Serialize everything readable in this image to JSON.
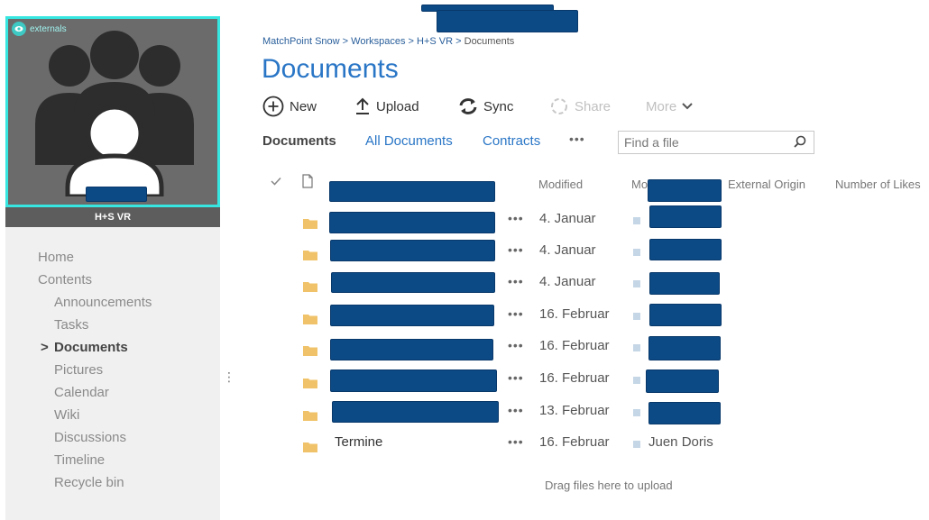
{
  "site": {
    "badge_label": "externals",
    "name": "H+S VR"
  },
  "breadcrumb": {
    "items": [
      "MatchPoint Snow",
      "Workspaces",
      "H+S VR"
    ],
    "separator": " > ",
    "current": "Documents"
  },
  "page_title": "Documents",
  "quick_launch": {
    "items": [
      {
        "label": "Home",
        "level": 0
      },
      {
        "label": "Contents",
        "level": 0
      },
      {
        "label": "Announcements",
        "level": 1
      },
      {
        "label": "Tasks",
        "level": 1
      },
      {
        "label": "Documents",
        "level": 1,
        "active": true
      },
      {
        "label": "Pictures",
        "level": 1
      },
      {
        "label": "Calendar",
        "level": 1
      },
      {
        "label": "Wiki",
        "level": 1
      },
      {
        "label": "Discussions",
        "level": 1
      },
      {
        "label": "Timeline",
        "level": 1
      },
      {
        "label": "Recycle bin",
        "level": 1
      }
    ],
    "active_marker": ">"
  },
  "commands": {
    "new": "New",
    "upload": "Upload",
    "sync": "Sync",
    "share": "Share",
    "more": "More"
  },
  "views": {
    "current": "Documents",
    "all_documents": "All Documents",
    "contracts": "Contracts",
    "more": "•••"
  },
  "search": {
    "placeholder": "Find a file"
  },
  "columns": {
    "modified": "Modified",
    "modified_by_prefix": "Mo",
    "external_origin": "External Origin",
    "likes": "Number of Likes"
  },
  "rows": [
    {
      "name": "",
      "modified": "4. Januar",
      "modified_by": ""
    },
    {
      "name": "",
      "modified": "4. Januar",
      "modified_by": ""
    },
    {
      "name": "",
      "modified": "4. Januar",
      "modified_by": ""
    },
    {
      "name": "",
      "modified": "16. Februar",
      "modified_by": ""
    },
    {
      "name": "",
      "modified": "16. Februar",
      "modified_by": ""
    },
    {
      "name": "",
      "modified": "16. Februar",
      "modified_by": ""
    },
    {
      "name": "",
      "modified": "13. Februar",
      "modified_by": ""
    },
    {
      "name": "Termine",
      "modified": "16. Februar",
      "modified_by": "Juen Doris"
    }
  ],
  "row_menu": "•••",
  "drag_hint": "Drag files here to upload",
  "colors": {
    "accent_blue": "#2a76c6",
    "tile_border": "#37e6e0",
    "folder": "#f0c36a",
    "redaction": "#0c4a86"
  }
}
